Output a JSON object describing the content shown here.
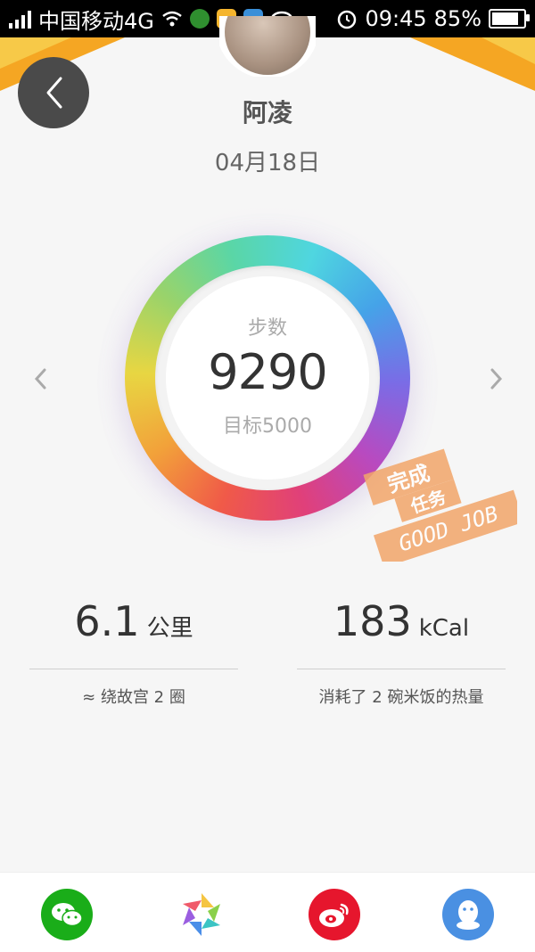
{
  "status_bar": {
    "carrier": "中国移动4G",
    "time": "09:45",
    "battery": "85%",
    "battery_level": 0.85
  },
  "header": {
    "back_icon": "chevron-left-icon",
    "name": "阿凌",
    "date": "04月18日"
  },
  "steps": {
    "label": "步数",
    "value": "9290",
    "goal": "目标5000",
    "prev_icon": "chevron-left-icon",
    "next_icon": "chevron-right-icon"
  },
  "stamp": {
    "line1": "完成",
    "line2": "任务",
    "line3": "GOOD JOB",
    "color": "#f2a66a"
  },
  "stats": {
    "distance": {
      "value": "6.1",
      "unit": "公里",
      "desc": "≈ 绕故宫 2 圈"
    },
    "calories": {
      "value": "183",
      "unit": "kCal",
      "desc": "消耗了 2 碗米饭的热量"
    }
  },
  "share": [
    {
      "icon": "wechat-icon",
      "color": "#1aad19"
    },
    {
      "icon": "moments-icon",
      "color": "#ffffff"
    },
    {
      "icon": "weibo-icon",
      "color": "#e6162d"
    },
    {
      "icon": "qq-icon",
      "color": "#4a90e2"
    }
  ]
}
